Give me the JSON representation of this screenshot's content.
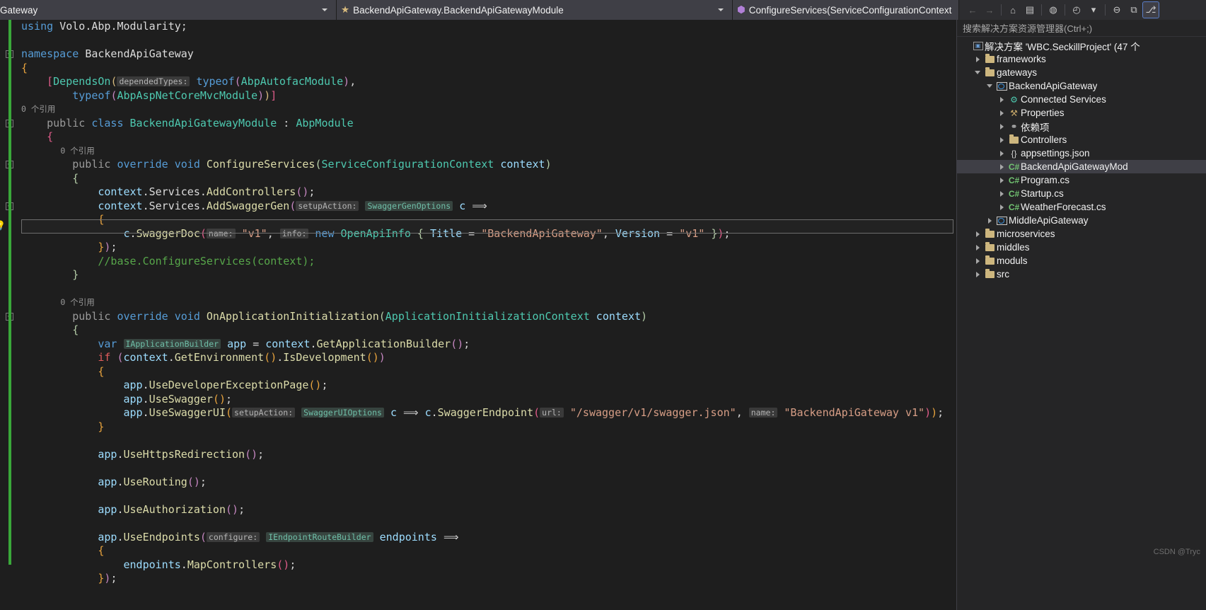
{
  "topbar": {
    "scope": {
      "label": "Gateway",
      "icon": "chevron-down-icon"
    },
    "type": {
      "label": "BackendApiGateway.BackendApiGatewayModule",
      "icon": "class-icon"
    },
    "member": {
      "label": "ConfigureServices(ServiceConfigurationContext contex",
      "icon": "method-icon"
    },
    "tools": [
      {
        "name": "navigate-back-button",
        "glyph": "←",
        "state": "disabled"
      },
      {
        "name": "navigate-forward-button",
        "glyph": "→",
        "state": "disabled"
      },
      {
        "name": "home-button",
        "glyph": "⌂",
        "state": "normal"
      },
      {
        "name": "sync-views-button",
        "glyph": "▤",
        "state": "normal"
      },
      {
        "name": "web-browser-button",
        "glyph": "◍",
        "state": "normal"
      },
      {
        "name": "history-button",
        "glyph": "◴",
        "state": "normal"
      },
      {
        "name": "history-dropdown-button",
        "glyph": "▾",
        "state": "normal"
      },
      {
        "name": "collapse-pane-button",
        "glyph": "⊖",
        "state": "normal"
      },
      {
        "name": "new-window-button",
        "glyph": "⧉",
        "state": "normal"
      },
      {
        "name": "solution-explorer-button",
        "glyph": "⎇",
        "state": "selected"
      }
    ]
  },
  "editor": {
    "lines": [
      {
        "fold": null,
        "html": "<span class='kw'>using</span> <span class='ns'>Volo</span>.<span class='ns'>Abp</span>.<span class='ns'>Modularity</span><span class='op'>;</span>"
      },
      {
        "fold": null,
        "html": ""
      },
      {
        "fold": "open",
        "html": "<span class='kw'>namespace</span> <span class='ns'>BackendApiGateway</span>"
      },
      {
        "fold": null,
        "html": "<span class='org'>{</span>"
      },
      {
        "fold": null,
        "html": "    <span class='pnk'>[</span><span class='typ'>DependsOn</span><span class='ylw'>(</span><span class='ihint'>dependedTypes:</span> <span class='kw'>typeof</span><span class='prp'>(</span><span class='typ'>AbpAutofacModule</span><span class='prp'>)</span><span class='op'>,</span>"
      },
      {
        "fold": null,
        "html": "        <span class='kw'>typeof</span><span class='prp'>(</span><span class='typ'>AbpAspNetCoreMvcModule</span><span class='prp'>)</span><span class='ylw'>)</span><span class='pnk'>]</span>"
      },
      {
        "fold": null,
        "hint": "0 个引用"
      },
      {
        "fold": "open",
        "html": "    <span class='kwmod'>public</span> <span class='kw'>class</span> <span class='typ'>BackendApiGatewayModule</span> <span class='op'>:</span> <span class='typ'>AbpModule</span>"
      },
      {
        "fold": null,
        "html": "    <span class='pnk'>{</span>"
      },
      {
        "fold": null,
        "hint": "        0 个引用"
      },
      {
        "fold": "open",
        "html": "        <span class='kwmod'>public</span> <span class='kw'>override</span> <span class='kw'>void</span> <span class='meth'>ConfigureServices</span><span class='grn'>(</span><span class='typ'>ServiceConfigurationContext</span> <span class='id'>context</span><span class='grn'>)</span>"
      },
      {
        "fold": null,
        "html": "        <span class='grn'>{</span>"
      },
      {
        "fold": null,
        "html": "            <span class='id'>context</span>.<span class='ns'>Services</span>.<span class='meth'>AddControllers</span><span class='prp'>()</span><span class='op'>;</span>"
      },
      {
        "fold": "open",
        "html": "            <span class='id'>context</span>.<span class='ns'>Services</span>.<span class='meth'>AddSwaggerGen</span><span class='prp'>(</span><span class='ihint'>setupAction:</span> <span class='ihint tp'>SwaggerGenOptions</span> <span class='id'>c</span> <span class='arrow'>⟹</span>"
      },
      {
        "fold": null,
        "html": "            <span class='org'>{</span>"
      },
      {
        "fold": null,
        "html": "                <span class='id'>c</span>.<span class='meth'>SwaggerDoc</span><span class='pnk'>(</span><span class='ihint'>name:</span> <span class='str'>\"v1\"</span><span class='op'>,</span> <span class='ihint'>info:</span> <span class='kw'>new</span> <span class='typ'>OpenApiInfo</span> <span class='grn'>{</span> <span class='id'>Title</span> <span class='op'>=</span> <span class='str'>\"BackendApiGateway\"</span><span class='op'>,</span> <span class='id'>Version</span> <span class='op'>=</span> <span class='str'>\"v1\"</span> <span class='grn'>}</span><span class='pnk'>)</span><span class='op'>;</span>"
      },
      {
        "fold": null,
        "html": "            <span class='org'>}</span><span class='prp'>)</span><span class='op'>;</span>"
      },
      {
        "fold": null,
        "html": "            <span class='cmt'>//base.ConfigureServices(context);</span>"
      },
      {
        "fold": null,
        "html": "        <span class='grn'>}</span>"
      },
      {
        "fold": null,
        "html": ""
      },
      {
        "fold": null,
        "hint": "        0 个引用"
      },
      {
        "fold": "open",
        "html": "        <span class='kwmod'>public</span> <span class='kw'>override</span> <span class='kw'>void</span> <span class='meth'>OnApplicationInitialization</span><span class='grn'>(</span><span class='typ'>ApplicationInitializationContext</span> <span class='id'>context</span><span class='grn'>)</span>"
      },
      {
        "fold": null,
        "html": "        <span class='grn'>{</span>"
      },
      {
        "fold": null,
        "html": "            <span class='kw'>var</span> <span class='ihint tp'>IApplicationBuilder</span> <span class='id'>app</span> <span class='op'>=</span> <span class='id'>context</span>.<span class='meth'>GetApplicationBuilder</span><span class='prp'>()</span><span class='op'>;</span>"
      },
      {
        "fold": null,
        "html": "            <span class='kw' style='color:#e05c5c'>if</span> <span class='prp'>(</span><span class='id'>context</span>.<span class='meth'>GetEnvironment</span><span class='org'>()</span>.<span class='meth'>IsDevelopment</span><span class='org'>()</span><span class='prp'>)</span>"
      },
      {
        "fold": null,
        "html": "            <span class='org'>{</span>"
      },
      {
        "fold": null,
        "html": "                <span class='id'>app</span>.<span class='meth'>UseDeveloperExceptionPage</span><span class='org'>()</span><span class='op'>;</span>"
      },
      {
        "fold": null,
        "html": "                <span class='id'>app</span>.<span class='meth'>UseSwagger</span><span class='org'>()</span><span class='op'>;</span>"
      },
      {
        "fold": null,
        "html": "                <span class='id'>app</span>.<span class='meth'>UseSwaggerUI</span><span class='org'>(</span><span class='ihint'>setupAction:</span> <span class='ihint tp'>SwaggerUIOptions</span> <span class='id'>c</span> <span class='arrow'>⟹</span> <span class='id'>c</span>.<span class='meth'>SwaggerEndpoint</span><span class='pnk'>(</span><span class='ihint'>url:</span> <span class='str'>\"/swagger/v1/swagger.json\"</span><span class='op'>,</span> <span class='ihint'>name:</span> <span class='str'>\"BackendApiGateway v1\"</span><span class='pnk'>)</span><span class='org'>)</span><span class='op'>;</span>"
      },
      {
        "fold": null,
        "html": "            <span class='org'>}</span>"
      },
      {
        "fold": null,
        "html": ""
      },
      {
        "fold": null,
        "html": "            <span class='id'>app</span>.<span class='meth'>UseHttpsRedirection</span><span class='prp'>()</span><span class='op'>;</span>"
      },
      {
        "fold": null,
        "html": ""
      },
      {
        "fold": null,
        "html": "            <span class='id'>app</span>.<span class='meth'>UseRouting</span><span class='prp'>()</span><span class='op'>;</span>"
      },
      {
        "fold": null,
        "html": ""
      },
      {
        "fold": null,
        "html": "            <span class='id'>app</span>.<span class='meth'>UseAuthorization</span><span class='prp'>()</span><span class='op'>;</span>"
      },
      {
        "fold": null,
        "html": ""
      },
      {
        "fold": null,
        "html": "            <span class='id'>app</span>.<span class='meth'>UseEndpoints</span><span class='prp'>(</span><span class='ihint'>configure:</span> <span class='ihint tp'>IEndpointRouteBuilder</span> <span class='id'>endpoints</span> <span class='arrow'>⟹</span>"
      },
      {
        "fold": null,
        "html": "            <span class='org'>{</span>"
      },
      {
        "fold": null,
        "html": "                <span class='id'>endpoints</span>.<span class='meth'>MapControllers</span><span class='pnk'>()</span><span class='op'>;</span>"
      },
      {
        "fold": null,
        "html": "            <span class='org'>}</span><span class='prp'>)</span><span class='op'>;</span>"
      }
    ]
  },
  "solution": {
    "search_placeholder": "搜索解决方案资源管理器(Ctrl+;)",
    "tree": [
      {
        "label": "解决方案 'WBC.SeckillProject' (47 个",
        "indent": 0,
        "twisty": "none",
        "icon": "solution-icon",
        "selected": false
      },
      {
        "label": "frameworks",
        "indent": 1,
        "twisty": "closed",
        "icon": "folder-icon",
        "selected": false
      },
      {
        "label": "gateways",
        "indent": 1,
        "twisty": "open",
        "icon": "folder-icon",
        "selected": false
      },
      {
        "label": "BackendApiGateway",
        "indent": 2,
        "twisty": "open",
        "icon": "project-icon",
        "selected": false
      },
      {
        "label": "Connected Services",
        "indent": 3,
        "twisty": "closed",
        "icon": "connected-services-icon",
        "selected": false
      },
      {
        "label": "Properties",
        "indent": 3,
        "twisty": "closed",
        "icon": "properties-icon",
        "selected": false
      },
      {
        "label": "依赖项",
        "indent": 3,
        "twisty": "closed",
        "icon": "dependencies-icon",
        "selected": false
      },
      {
        "label": "Controllers",
        "indent": 3,
        "twisty": "closed",
        "icon": "folder-icon",
        "selected": false
      },
      {
        "label": "appsettings.json",
        "indent": 3,
        "twisty": "closed",
        "icon": "json-icon",
        "selected": false
      },
      {
        "label": "BackendApiGatewayMod",
        "indent": 3,
        "twisty": "closed",
        "icon": "csharp-icon",
        "selected": true
      },
      {
        "label": "Program.cs",
        "indent": 3,
        "twisty": "closed",
        "icon": "csharp-icon",
        "selected": false
      },
      {
        "label": "Startup.cs",
        "indent": 3,
        "twisty": "closed",
        "icon": "csharp-icon",
        "selected": false
      },
      {
        "label": "WeatherForecast.cs",
        "indent": 3,
        "twisty": "closed",
        "icon": "csharp-icon",
        "selected": false
      },
      {
        "label": "MiddleApiGateway",
        "indent": 2,
        "twisty": "closed",
        "icon": "project-icon",
        "selected": false
      },
      {
        "label": "microservices",
        "indent": 1,
        "twisty": "closed",
        "icon": "folder-icon",
        "selected": false
      },
      {
        "label": "middles",
        "indent": 1,
        "twisty": "closed",
        "icon": "folder-icon",
        "selected": false
      },
      {
        "label": "moduls",
        "indent": 1,
        "twisty": "closed",
        "icon": "folder-icon",
        "selected": false
      },
      {
        "label": "src",
        "indent": 1,
        "twisty": "closed",
        "icon": "folder-icon",
        "selected": false
      }
    ]
  },
  "watermark": "CSDN @Tryc"
}
